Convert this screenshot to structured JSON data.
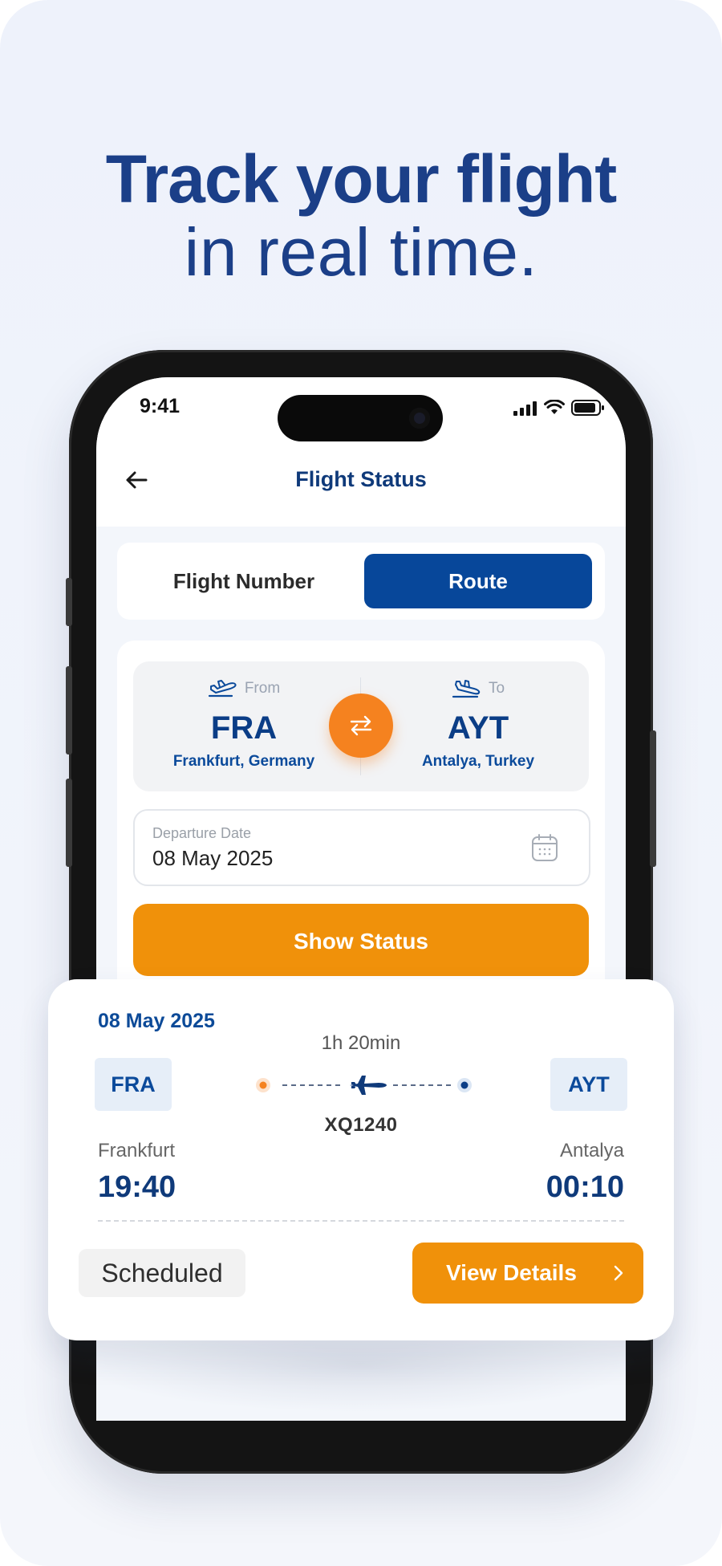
{
  "headline": {
    "line1": "Track your flight",
    "line2": "in real time."
  },
  "statusbar": {
    "time": "9:41"
  },
  "appbar": {
    "title": "Flight Status"
  },
  "segmented": {
    "option_flight_number": "Flight Number",
    "option_route": "Route",
    "selected": "Route"
  },
  "route": {
    "from_label": "From",
    "from_code": "FRA",
    "from_city": "Frankfurt, Germany",
    "to_label": "To",
    "to_code": "AYT",
    "to_city": "Antalya, Turkey"
  },
  "departure": {
    "label": "Departure Date",
    "value": "08 May 2025"
  },
  "show_status_label": "Show Status",
  "ticket": {
    "date": "08 May 2025",
    "duration": "1h 20min",
    "origin_code": "FRA",
    "destination_code": "AYT",
    "flight_number": "XQ1240",
    "origin_city": "Frankfurt",
    "destination_city": "Antalya",
    "departure_time": "19:40",
    "arrival_time": "00:10",
    "status": "Scheduled",
    "view_details_label": "View Details"
  },
  "colors": {
    "brand_blue": "#07479a",
    "accent_orange": "#f0910a",
    "swap_orange": "#f5821f",
    "headline_blue": "#1b3f88"
  },
  "icons": [
    "back-arrow-icon",
    "takeoff-icon",
    "landing-icon",
    "swap-icon",
    "calendar-icon",
    "airplane-icon",
    "chevron-right-icon",
    "signal-icon",
    "wifi-icon",
    "battery-icon"
  ]
}
